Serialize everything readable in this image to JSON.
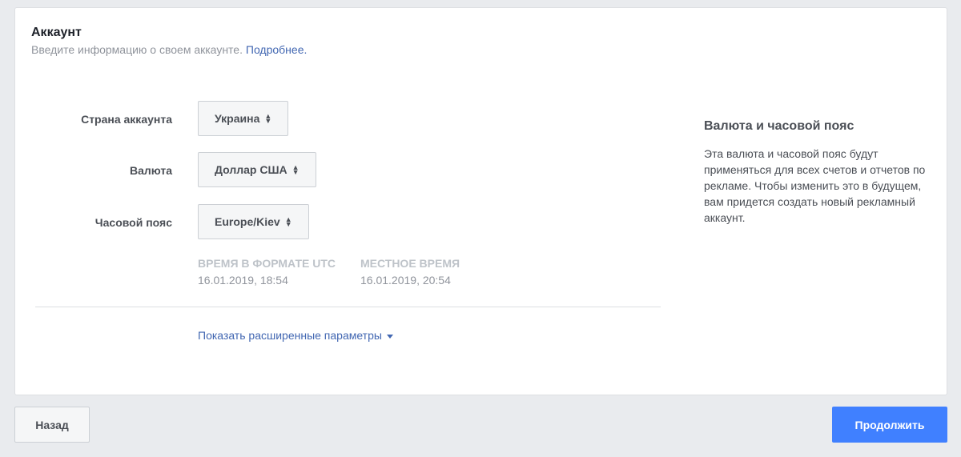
{
  "account": {
    "title": "Аккаунт",
    "subtitle": "Введите информацию о своем аккаунте.",
    "subtitle_link": "Подробнее."
  },
  "fields": {
    "country": {
      "label": "Страна аккаунта",
      "value": "Украина"
    },
    "currency": {
      "label": "Валюта",
      "value": "Доллар США"
    },
    "timezone": {
      "label": "Часовой пояс",
      "value": "Europe/Kiev"
    }
  },
  "time": {
    "utc_label": "ВРЕМЯ В ФОРМАТЕ UTC",
    "utc_value": "16.01.2019, 18:54",
    "local_label": "МЕСТНОЕ ВРЕМЯ",
    "local_value": "16.01.2019, 20:54"
  },
  "advanced_link": "Показать расширенные параметры",
  "side": {
    "title": "Валюта и часовой пояс",
    "text": "Эта валюта и часовой пояс будут применяться для всех счетов и отчетов по рекламе. Чтобы изменить это в будущем, вам придется создать новый рекламный аккаунт."
  },
  "buttons": {
    "back": "Назад",
    "continue": "Продолжить"
  },
  "colors": {
    "accent": "#4080ff",
    "link": "#4267b2",
    "background": "#e9ebee"
  },
  "icons": {
    "select_arrows": "sort-arrows-icon",
    "advanced_caret": "caret-down-icon"
  }
}
